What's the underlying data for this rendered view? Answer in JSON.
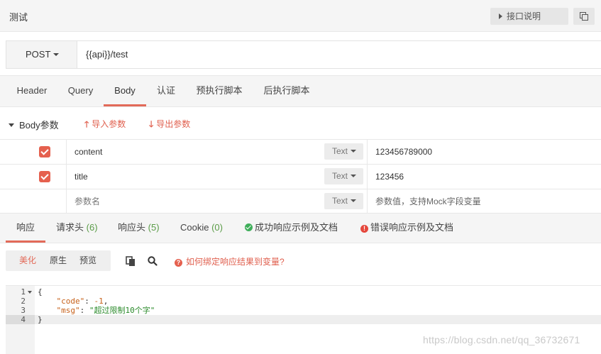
{
  "header": {
    "title": "测试",
    "doc_button": "接口说明"
  },
  "request": {
    "method": "POST",
    "url": "{{api}}/test"
  },
  "request_tabs": [
    {
      "label": "Header"
    },
    {
      "label": "Query"
    },
    {
      "label": "Body",
      "active": true
    },
    {
      "label": "认证"
    },
    {
      "label": "预执行脚本"
    },
    {
      "label": "后执行脚本"
    }
  ],
  "body_section": {
    "label": "Body参数",
    "import_label": "导入参数",
    "export_label": "导出参数"
  },
  "params": [
    {
      "checked": true,
      "name": "content",
      "type": "Text",
      "value": "123456789000"
    },
    {
      "checked": true,
      "name": "title",
      "type": "Text",
      "value": "123456"
    },
    {
      "checked": false,
      "name_placeholder": "参数名",
      "type": "Text",
      "value_placeholder": "参数值，支持Mock字段变量"
    }
  ],
  "response_tabs": [
    {
      "label": "响应",
      "active": true
    },
    {
      "label": "请求头",
      "count": "(6)"
    },
    {
      "label": "响应头",
      "count": "(5)"
    },
    {
      "label": "Cookie",
      "count": "(0)"
    },
    {
      "label": "成功响应示例及文档"
    },
    {
      "label": "错误响应示例及文档"
    }
  ],
  "view_modes": [
    {
      "label": "美化",
      "active": true
    },
    {
      "label": "原生"
    },
    {
      "label": "预览"
    }
  ],
  "help_link": "如何绑定响应结果到变量?",
  "code": {
    "line_numbers": [
      "1",
      "2",
      "3",
      "4"
    ],
    "open_brace": "{",
    "close_brace": "}",
    "code_key": "\"code\"",
    "code_value": "-1",
    "msg_key": "\"msg\"",
    "msg_value": "\"超过限制10个字\""
  },
  "watermark": "https://blog.csdn.net/qq_36732671",
  "colors": {
    "accent": "#e26a59",
    "checkbox": "#e5604e",
    "success": "#3fae5a",
    "error": "#e5473c"
  }
}
